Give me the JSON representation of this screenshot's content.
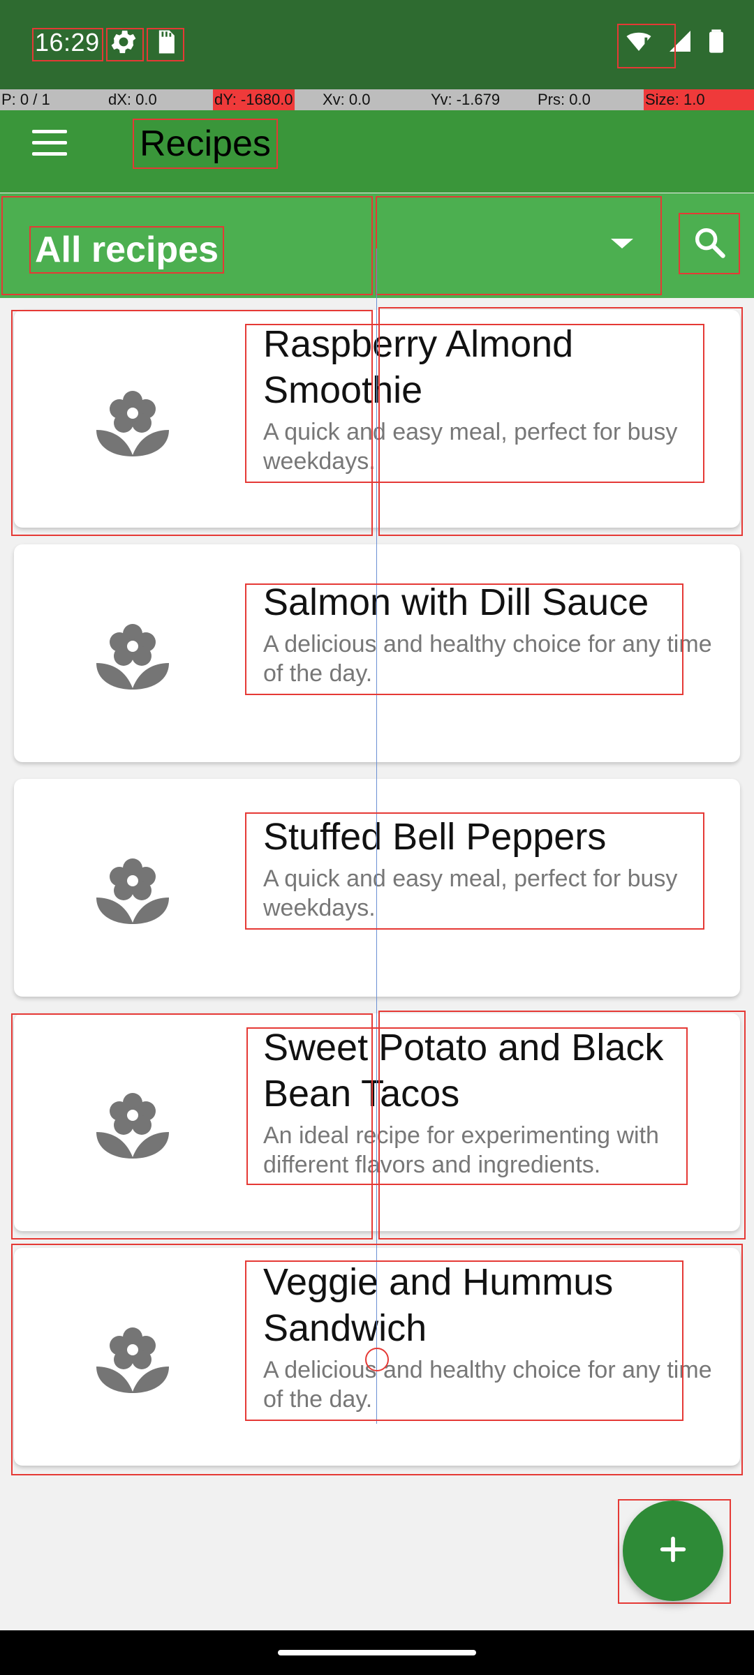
{
  "status_bar": {
    "time": "16:29",
    "icons": [
      "gear-icon",
      "sd-card-icon",
      "wifi-alert-icon",
      "signal-icon",
      "battery-icon"
    ]
  },
  "pointer_info": {
    "p": "P: 0 / 1",
    "dx": "dX: 0.0",
    "dy": "dY: -1680.0",
    "xv": "Xv: 0.0",
    "yv": "Yv: -1.679",
    "prs": "Prs: 0.0",
    "size": "Size: 1.0"
  },
  "app_bar": {
    "title": "Recipes",
    "menu_icon": "menu-icon"
  },
  "filter": {
    "label": "All recipes",
    "dropdown_value": "",
    "search_icon": "search-icon"
  },
  "recipes": [
    {
      "title": "Raspberry Almond Smoothie",
      "description": "A quick and easy meal, perfect for busy weekdays."
    },
    {
      "title": "Salmon with Dill Sauce",
      "description": "A delicious and healthy choice for any time of the day."
    },
    {
      "title": "Stuffed Bell Peppers",
      "description": "A quick and easy meal, perfect for busy weekdays."
    },
    {
      "title": "Sweet Potato and Black Bean Tacos",
      "description": "An ideal recipe for experimenting with different flavors and ingredients."
    },
    {
      "title": "Veggie and Hummus Sandwich",
      "description": "A delicious and healthy choice for any time of the day."
    }
  ],
  "fab": {
    "icon": "plus-icon"
  },
  "colors": {
    "status_bar": "#2e6b30",
    "app_bar": "#3a963a",
    "filter_bar": "#4caf50",
    "fab": "#2e8b37",
    "debug_outline": "#e53935"
  }
}
